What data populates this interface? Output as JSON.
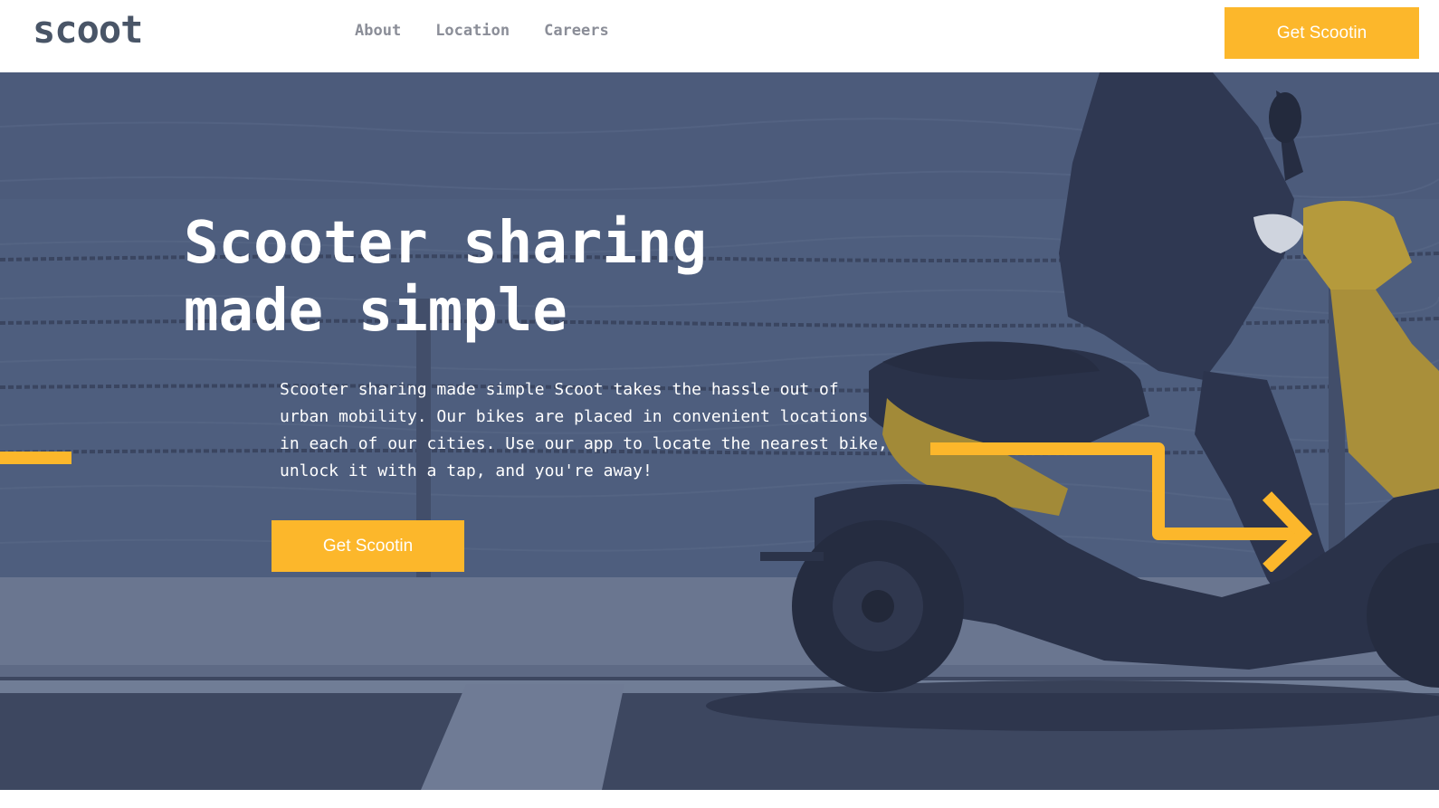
{
  "header": {
    "logo": "scoot",
    "nav": [
      {
        "label": "About"
      },
      {
        "label": "Location"
      },
      {
        "label": "Careers"
      }
    ],
    "cta_label": "Get Scootin"
  },
  "hero": {
    "title_line1": "Scooter sharing",
    "title_line2": "made simple",
    "description": "Scooter sharing made simple Scoot takes the hassle out of urban mobility. Our bikes are placed in convenient locations in each of our cities. Use our app to locate the nearest bike, unlock it with a tap, and you're away!",
    "cta_label": "Get Scootin"
  },
  "colors": {
    "accent": "#fcb72b",
    "navy": "#495567",
    "hero_overlay": "#4b5a78",
    "nav_text": "#8b8e98"
  },
  "icons": [
    "right-arrow-decoration",
    "left-line-decoration",
    "scooter-photo"
  ]
}
